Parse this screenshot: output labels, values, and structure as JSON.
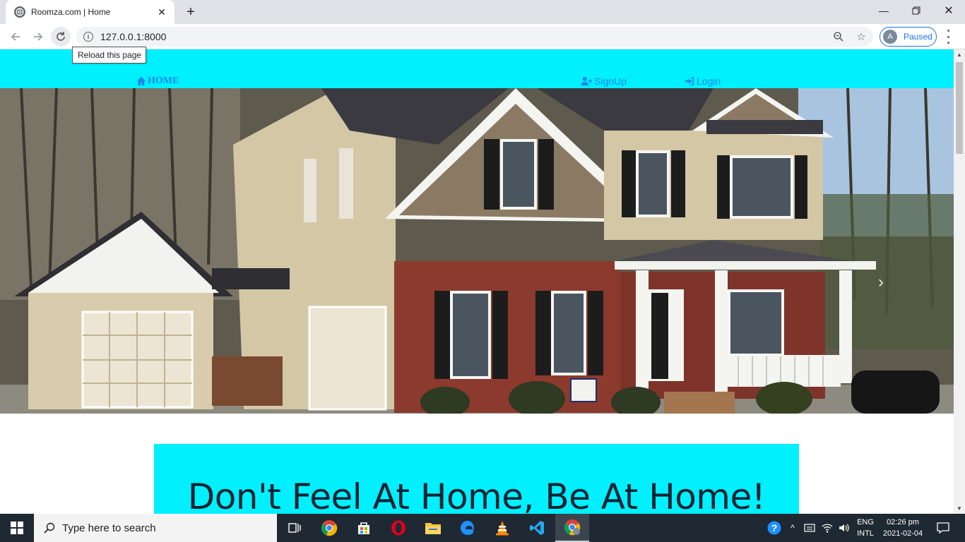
{
  "browser": {
    "tab_title": "Roomza.com | Home",
    "url": "127.0.0.1:8000",
    "profile_initial": "A",
    "profile_status": "Paused",
    "tooltip": "Reload this page"
  },
  "site": {
    "nav": {
      "home": "HOME",
      "signup": "SignUp",
      "login": "Login"
    },
    "tagline": "Don't Feel At Home, Be At Home!",
    "colors": {
      "accent": "#00f0ff",
      "link": "#1e88e5"
    }
  },
  "taskbar": {
    "search_placeholder": "Type here to search",
    "lang_line1": "ENG",
    "lang_line2": "INTL",
    "time": "02:26 pm",
    "date": "2021-02-04"
  }
}
